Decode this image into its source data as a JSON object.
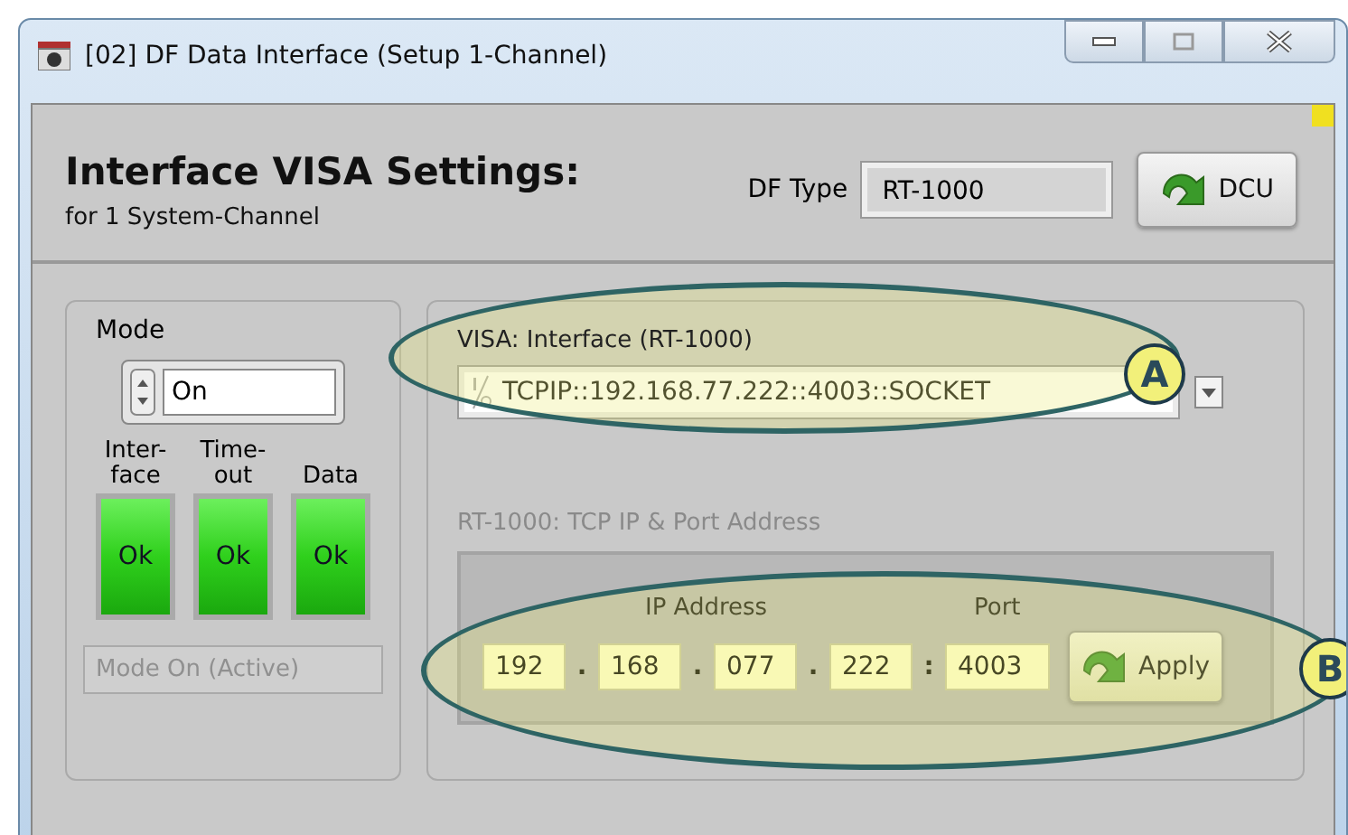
{
  "window": {
    "title": "[02] DF Data Interface (Setup 1-Channel)"
  },
  "header": {
    "title": "Interface VISA Settings:",
    "subtitle": "for 1 System-Channel",
    "df_type_label": "DF Type",
    "df_type_value": "RT-1000",
    "dcu_button": "DCU"
  },
  "mode": {
    "label": "Mode",
    "value": "On",
    "status": "Mode On (Active)",
    "status_disabled": true,
    "indicators": [
      {
        "label": "Inter-\nface",
        "text": "Ok",
        "on": true
      },
      {
        "label": "Time-\nout",
        "text": "Ok",
        "on": true
      },
      {
        "label": "Data",
        "text": "Ok",
        "on": true
      }
    ]
  },
  "visa": {
    "label": "VISA: Interface (RT-1000)",
    "value": "TCPIP::192.168.77.222::4003::SOCKET"
  },
  "tcp": {
    "label": "RT-1000: TCP IP & Port Address",
    "disabled": true,
    "ip_label": "IP Address",
    "port_label": "Port",
    "port": "4003",
    "apply_button": "Apply",
    "octets": [
      {
        "value": "192",
        "separator": "."
      },
      {
        "value": "168",
        "separator": "."
      },
      {
        "value": "077",
        "separator": "."
      },
      {
        "value": "222",
        "separator": ":"
      }
    ]
  },
  "annotations": [
    {
      "label": "A"
    },
    {
      "label": "B"
    }
  ]
}
